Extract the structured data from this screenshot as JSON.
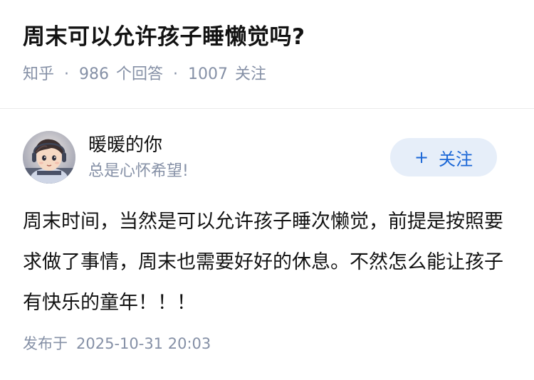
{
  "question": {
    "title": "周末可以允许孩子睡懒觉吗?",
    "source": "知乎",
    "separator": "·",
    "answer_count": "986",
    "answer_label": "个回答",
    "follower_count": "1007",
    "follower_label": "关注"
  },
  "author": {
    "avatar_icon": "avatar-cartoon-boy",
    "name": "暖暖的你",
    "bio": "总是心怀希望!",
    "follow_icon": "+",
    "follow_label": "关注"
  },
  "answer": {
    "content": "周末时间，当然是可以允许孩子睡次懒觉，前提是按照要求做了事情，周末也需要好好的休息。不然怎么能让孩子有快乐的童年！！！"
  },
  "publish": {
    "label": "发布于",
    "time": "2025-10-31 20:03"
  },
  "colors": {
    "text": "#121212",
    "meta": "#8590a6",
    "accent": "#1a66d6",
    "follow_bg": "#e6eef9",
    "divider": "#ebebeb"
  }
}
